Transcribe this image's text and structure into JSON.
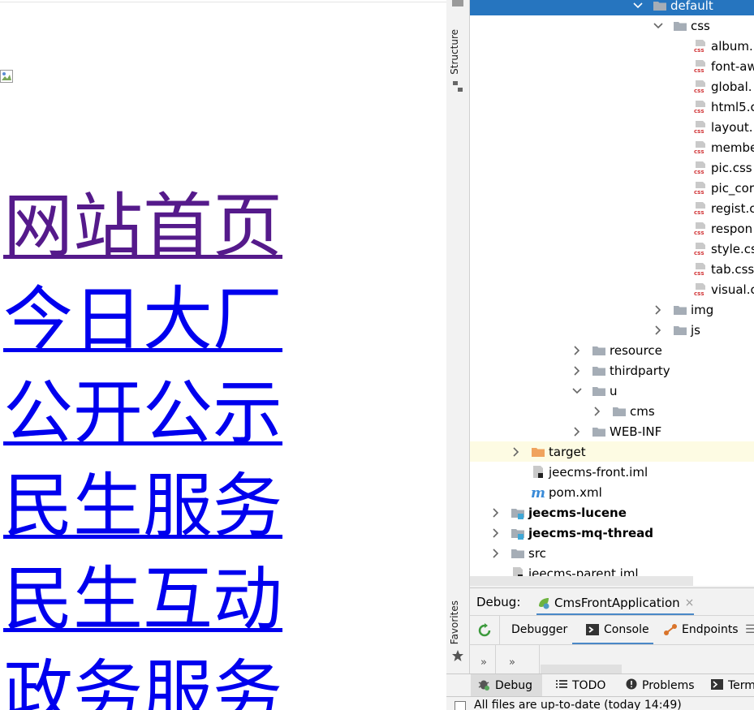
{
  "browser": {
    "nav_links": [
      {
        "label": "网站首页",
        "visited": true
      },
      {
        "label": "今日大厂",
        "visited": false
      },
      {
        "label": "公开公示",
        "visited": false
      },
      {
        "label": "民生服务",
        "visited": false
      },
      {
        "label": "民生互动",
        "visited": false
      },
      {
        "label": "政务服务",
        "visited": false
      }
    ]
  },
  "ide": {
    "side_tabs": {
      "structure": "Structure",
      "favorites": "Favorites"
    },
    "tree": [
      {
        "label": "default",
        "type": "folder",
        "chevron": "down",
        "state": "selected"
      },
      {
        "label": "css",
        "type": "folder",
        "chevron": "down"
      },
      {
        "label": "album.",
        "type": "css"
      },
      {
        "label": "font-aw",
        "type": "css"
      },
      {
        "label": "global.",
        "type": "css"
      },
      {
        "label": "html5.c",
        "type": "css"
      },
      {
        "label": "layout.",
        "type": "css"
      },
      {
        "label": "membe",
        "type": "css"
      },
      {
        "label": "pic.css",
        "type": "css"
      },
      {
        "label": "pic_cor",
        "type": "css"
      },
      {
        "label": "regist.c",
        "type": "css"
      },
      {
        "label": "respon",
        "type": "css"
      },
      {
        "label": "style.cs",
        "type": "css"
      },
      {
        "label": "tab.css",
        "type": "css"
      },
      {
        "label": "visual.c",
        "type": "css"
      },
      {
        "label": "img",
        "type": "folder",
        "chevron": "right"
      },
      {
        "label": "js",
        "type": "folder",
        "chevron": "right"
      },
      {
        "label": "resource",
        "type": "folder",
        "chevron": "right"
      },
      {
        "label": "thirdparty",
        "type": "folder",
        "chevron": "right"
      },
      {
        "label": "u",
        "type": "folder",
        "chevron": "down"
      },
      {
        "label": "cms",
        "type": "folder",
        "chevron": "right"
      },
      {
        "label": "WEB-INF",
        "type": "folder",
        "chevron": "right"
      },
      {
        "label": "target",
        "type": "folder-orange",
        "chevron": "right",
        "state": "highlight"
      },
      {
        "label": "jeecms-front.iml",
        "type": "iml"
      },
      {
        "label": "pom.xml",
        "type": "maven"
      },
      {
        "label": "jeecms-lucene",
        "type": "module",
        "chevron": "right",
        "bold": true
      },
      {
        "label": "jeecms-mq-thread",
        "type": "module",
        "chevron": "right",
        "bold": true
      },
      {
        "label": "src",
        "type": "folder",
        "chevron": "right"
      },
      {
        "label": "jeecms-parent.iml",
        "type": "iml"
      }
    ],
    "debug": {
      "title": "Debug:",
      "session_tab": "CmsFrontApplication",
      "close_glyph": "×",
      "toolbar": {
        "debugger": "Debugger",
        "console": "Console",
        "endpoints": "Endpoints"
      },
      "more_glyph": "»"
    },
    "bottom_tabs": [
      {
        "label": "Debug",
        "icon": "bug-icon",
        "active": true
      },
      {
        "label": "TODO",
        "icon": "list-icon",
        "active": false
      },
      {
        "label": "Problems",
        "icon": "info-icon",
        "active": false
      },
      {
        "label": "Termin",
        "icon": "terminal-icon",
        "active": false
      }
    ],
    "status": "All files are up-to-date (today 14:49)"
  },
  "colors": {
    "link": "#0000ee",
    "visited_link": "#551a8b",
    "selection": "#2675bf",
    "folder": "#a5adb6",
    "orange_folder": "#f0a35e"
  }
}
